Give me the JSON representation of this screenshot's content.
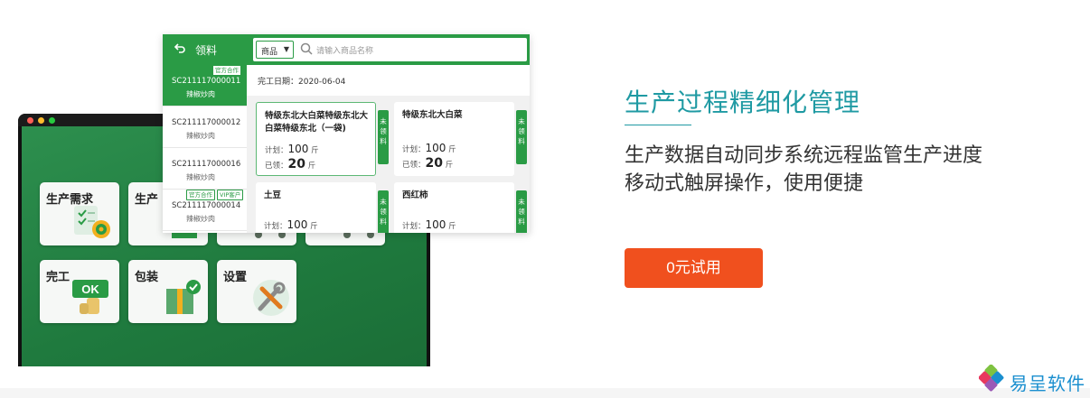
{
  "colors": {
    "brand_green": "#2a9b45",
    "accent_teal": "#1f9aa3",
    "cta_orange": "#f0501e",
    "logo_blue": "#1b8fcf"
  },
  "tablet": {
    "tiles": [
      {
        "label": "生产需求",
        "icon": "checklist-target-icon"
      },
      {
        "label": "生产",
        "icon": "production-icon"
      },
      {
        "label": "",
        "icon": "cart-icon"
      },
      {
        "label": "",
        "icon": "cart-icon"
      },
      {
        "label": "完工",
        "icon": "ok-sign-icon"
      },
      {
        "label": "包装",
        "icon": "package-icon"
      },
      {
        "label": "设置",
        "icon": "tools-icon"
      }
    ]
  },
  "phone": {
    "back_icon": "back-arrow-icon",
    "title": "领料",
    "search": {
      "category": "商品",
      "placeholder": "请输入商品名称",
      "icon": "search-icon"
    },
    "orders": [
      {
        "code": "SC211117000011",
        "name": "辣椒炒肉",
        "tags": [
          "官方合作"
        ],
        "active": true
      },
      {
        "code": "SC211117000012",
        "name": "辣椒炒肉",
        "tags": [],
        "active": false
      },
      {
        "code": "SC211117000016",
        "name": "辣椒炒肉",
        "tags": [],
        "active": false
      },
      {
        "code": "SC211117000014",
        "name": "辣椒炒肉",
        "tags": [
          "官方合作",
          "VIP客户"
        ],
        "active": false
      }
    ],
    "date_label": "完工日期：2020-06-04",
    "cards": [
      {
        "name": "特级东北大白菜特级东北大白菜特级东北（一袋)",
        "plan_label": "计划：",
        "plan_value": "100",
        "unit": "斤",
        "got_label": "已领：",
        "got_value": "20",
        "side": "未领料",
        "selected": true
      },
      {
        "name": "特级东北大白菜",
        "plan_label": "计划：",
        "plan_value": "100",
        "unit": "斤",
        "got_label": "已领：",
        "got_value": "20",
        "side": "未领料",
        "selected": false
      },
      {
        "name": "土豆",
        "plan_label": "计划：",
        "plan_value": "100",
        "unit": "斤",
        "side": "未领料",
        "selected": false
      },
      {
        "name": "西红柿",
        "plan_label": "计划：",
        "plan_value": "100",
        "unit": "斤",
        "side": "未领料",
        "selected": false
      }
    ]
  },
  "marketing": {
    "headline": "生产过程精细化管理",
    "desc_line1": "生产数据自动同步系统远程监管生产进度",
    "desc_line2": "移动式触屏操作，使用便捷",
    "cta": "0元试用"
  },
  "logo": {
    "text": "易呈软件",
    "icon": "yicheng-logo-icon"
  }
}
